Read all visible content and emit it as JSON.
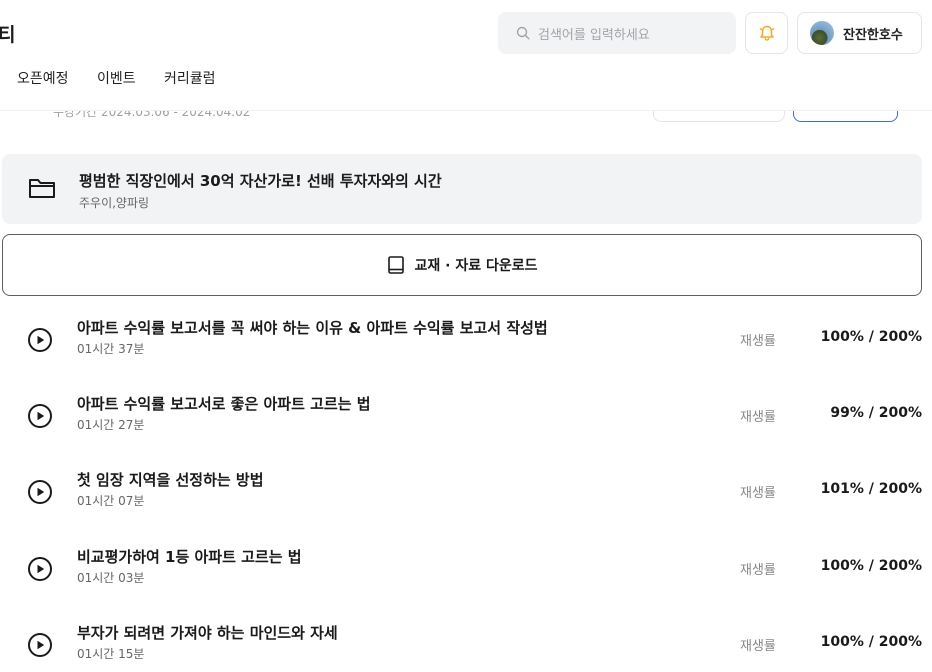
{
  "header": {
    "brand": "티",
    "search_placeholder": "검색어를 입력하세요",
    "user_name": "잔잔한호수"
  },
  "nav": {
    "leading_dot": ".",
    "items": [
      "오픈예정",
      "이벤트",
      "커리큘럼"
    ]
  },
  "previous_section": {
    "date_text": "수강기간 2024.03.06 - 2024.04.02"
  },
  "course": {
    "title": "평범한 직장인에서 30억 자산가로! 선배 투자자와의 시간",
    "instructors": "주우이,양파링"
  },
  "download": {
    "label": "교재 · 자료 다운로드"
  },
  "lessons": [
    {
      "title": "아파트 수익률 보고서를 꼭 써야 하는 이유 & 아파트 수익률 보고서 작성법",
      "duration": "01시간 37분",
      "rate_label": "재생률",
      "rate": "100% / 200%"
    },
    {
      "title": "아파트 수익률 보고서로 좋은 아파트 고르는 법",
      "duration": "01시간 27분",
      "rate_label": "재생률",
      "rate": "99% / 200%"
    },
    {
      "title": "첫 임장 지역을 선정하는 방법",
      "duration": "01시간 07분",
      "rate_label": "재생률",
      "rate": "101% / 200%"
    },
    {
      "title": "비교평가하여 1등 아파트 고르는 법",
      "duration": "01시간 03분",
      "rate_label": "재생률",
      "rate": "100% / 200%"
    },
    {
      "title": "부자가 되려면 가져야 하는 마인드와 자세",
      "duration": "01시간 15분",
      "rate_label": "재생률",
      "rate": "100% / 200%"
    }
  ],
  "colors": {
    "bell_accent": "#f5a623",
    "card_bg": "#f2f3f5",
    "primary_outline": "#3d6dd8"
  },
  "icons": {
    "search": "search-icon",
    "bell": "bell-icon",
    "folder": "folder-icon",
    "book": "book-icon",
    "play": "play-circle-icon"
  }
}
